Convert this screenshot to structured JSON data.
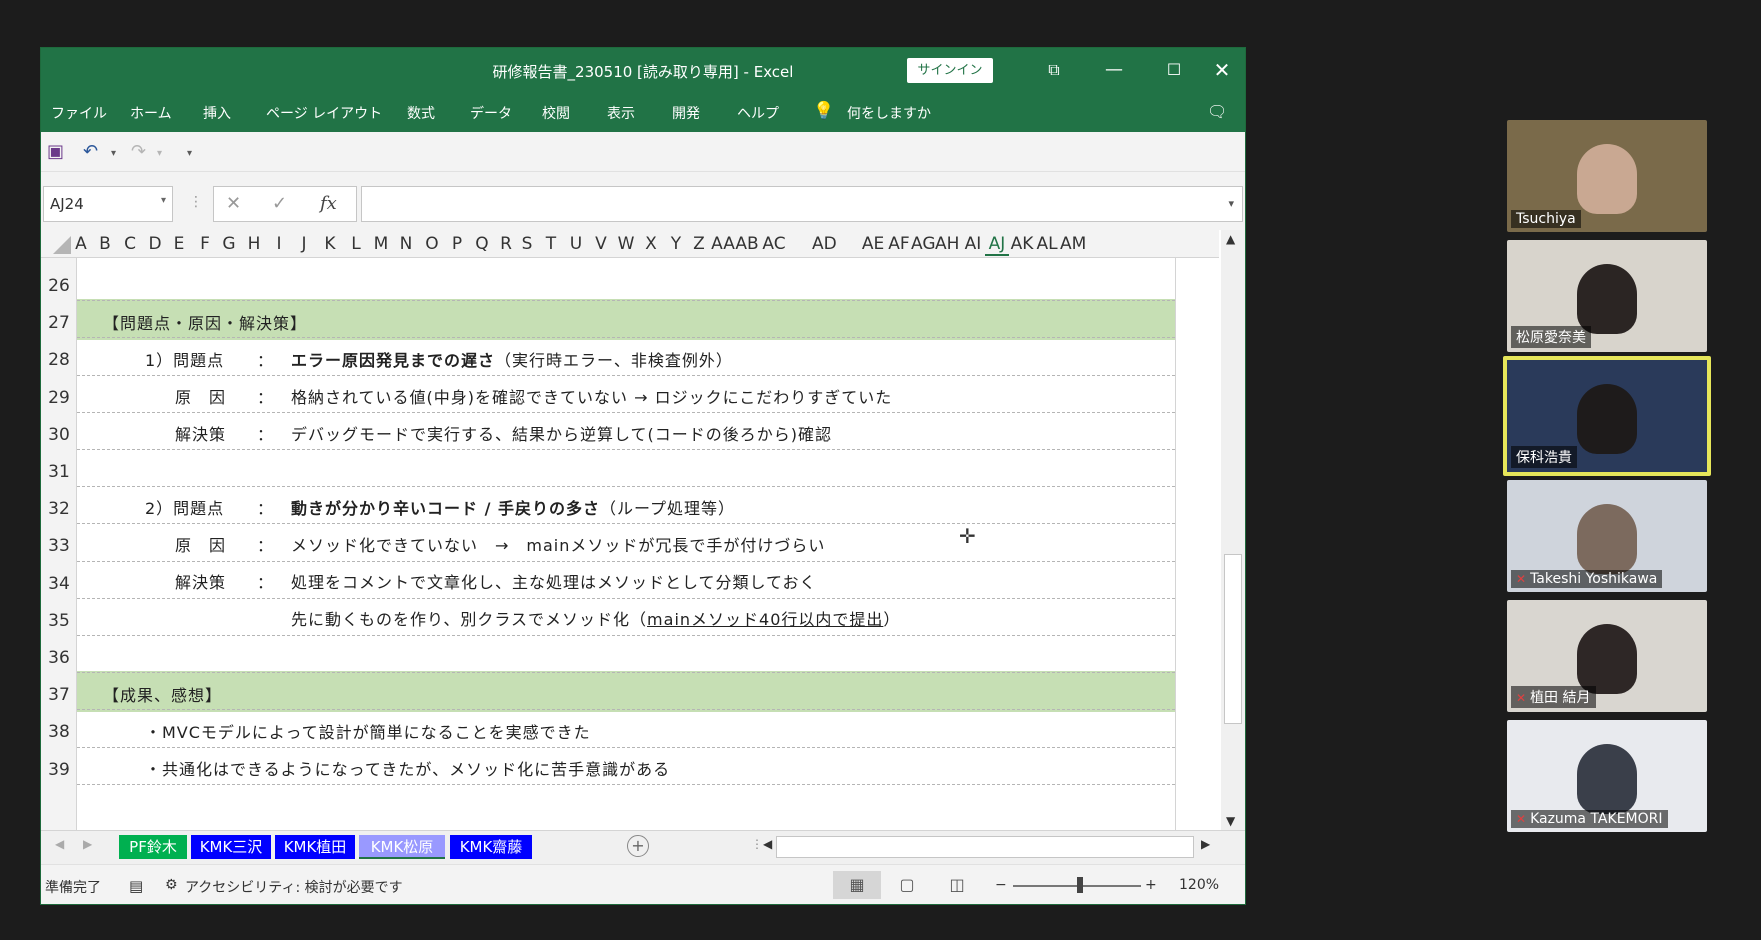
{
  "window": {
    "title": "研修報告書_230510  [読み取り専用]  -  Excel",
    "signin_label": "サインイン"
  },
  "menu": [
    "ファイル",
    "ホーム",
    "挿入",
    "ページ レイアウト",
    "数式",
    "データ",
    "校閲",
    "表示",
    "開発",
    "ヘルプ"
  ],
  "tell_me": "何をしますか",
  "name_box": "AJ24",
  "fx_label": "fx",
  "columns": [
    "A",
    "B",
    "C",
    "D",
    "E",
    "F",
    "G",
    "H",
    "I",
    "J",
    "K",
    "L",
    "M",
    "N",
    "O",
    "P",
    "Q",
    "R",
    "S",
    "T",
    "U",
    "V",
    "W",
    "X",
    "Y",
    "Z",
    "AA",
    "AB",
    "AC",
    "AD",
    "AE",
    "AF",
    "AG",
    "AH",
    "AI",
    "AJ",
    "AK",
    "AL",
    "AM"
  ],
  "selected_column": "AJ",
  "rows": [
    "26",
    "27",
    "28",
    "29",
    "30",
    "31",
    "32",
    "33",
    "34",
    "35",
    "36",
    "37",
    "38",
    "39"
  ],
  "cells": {
    "r27": "【問題点・原因・解決策】",
    "r28_num": "1）問題点",
    "r28_colon": "：",
    "r28_bold": "エラー原因発見までの遅さ",
    "r28_rest": "（実行時エラー、非検査例外）",
    "r29_label": "原　因",
    "r29_colon": "：",
    "r29_text": "格納されている値(中身)を確認できていない → ロジックにこだわりすぎていた",
    "r30_label": "解決策",
    "r30_colon": "：",
    "r30_text": "デバッグモードで実行する、結果から逆算して(コードの後ろから)確認",
    "r32_num": "2）問題点",
    "r32_colon": "：",
    "r32_bold": "動きが分かり辛いコード / 手戻りの多さ",
    "r32_rest": "（ループ処理等）",
    "r33_label": "原　因",
    "r33_colon": "：",
    "r33_text": "メソッド化できていない　→　mainメソッドが冗長で手が付けづらい",
    "r34_label": "解決策",
    "r34_colon": "：",
    "r34_text": "処理をコメントで文章化し、主な処理はメソッドとして分類しておく",
    "r35_text": "先に動くものを作り、別クラスでメソッド化（",
    "r35_underline": "mainメソッド40行以内で提出",
    "r35_close": "）",
    "r37": "【成果、感想】",
    "r38": "・MVCモデルによって設計が簡単になることを実感できた",
    "r39": "・共通化はできるようになってきたが、メソッド化に苦手意識がある"
  },
  "sheet_tabs": [
    {
      "label": "PF鈴木",
      "color": "#00b050"
    },
    {
      "label": "KMK三沢",
      "color": "#0000ff"
    },
    {
      "label": "KMK植田",
      "color": "#0000ff"
    },
    {
      "label": "KMK松原",
      "color": "#9999ff"
    },
    {
      "label": "KMK齋藤",
      "color": "#0000ff"
    }
  ],
  "status": {
    "ready": "準備完了",
    "accessibility": "アクセシビリティ: 検討が必要です",
    "zoom": "120%"
  },
  "participants": [
    {
      "name": "Tsuchiya",
      "muted": false,
      "active": false
    },
    {
      "name": "松原愛奈美",
      "muted": false,
      "active": false
    },
    {
      "name": "保科浩貴",
      "muted": false,
      "active": true
    },
    {
      "name": "Takeshi Yoshikawa",
      "muted": true,
      "active": false
    },
    {
      "name": "植田 結月",
      "muted": true,
      "active": false
    },
    {
      "name": "Kazuma TAKEMORI",
      "muted": true,
      "active": false
    }
  ]
}
